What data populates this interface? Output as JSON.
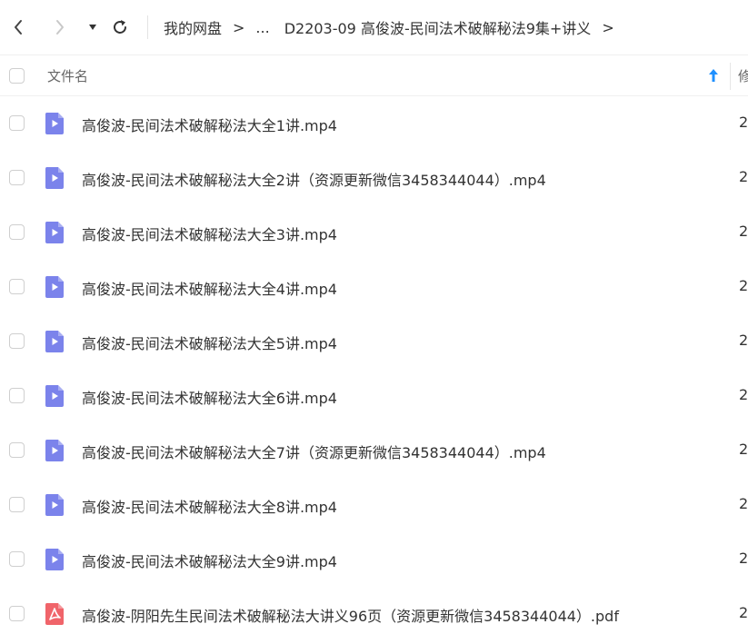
{
  "nav": {
    "back_icon": "chevron-left-icon",
    "forward_icon": "chevron-right-icon",
    "history_icon": "caret-down-icon",
    "refresh_icon": "refresh-icon"
  },
  "breadcrumb": {
    "root": "我的网盘",
    "sep1": ">",
    "ellipsis": "...",
    "current": "D2203-09 高俊波-民间法术破解秘法9集+讲义",
    "sep2": ">"
  },
  "header": {
    "name_label": "文件名",
    "sort_icon": "sort-asc-icon",
    "next_col_partial": "修"
  },
  "files": [
    {
      "name": "高俊波-民间法术破解秘法大全1讲.mp4",
      "type": "video",
      "partial": "2"
    },
    {
      "name": "高俊波-民间法术破解秘法大全2讲（资源更新微信3458344044）.mp4",
      "type": "video",
      "partial": "2"
    },
    {
      "name": "高俊波-民间法术破解秘法大全3讲.mp4",
      "type": "video",
      "partial": "2"
    },
    {
      "name": "高俊波-民间法术破解秘法大全4讲.mp4",
      "type": "video",
      "partial": "2"
    },
    {
      "name": "高俊波-民间法术破解秘法大全5讲.mp4",
      "type": "video",
      "partial": "2"
    },
    {
      "name": "高俊波-民间法术破解秘法大全6讲.mp4",
      "type": "video",
      "partial": "2"
    },
    {
      "name": "高俊波-民间法术破解秘法大全7讲（资源更新微信3458344044）.mp4",
      "type": "video",
      "partial": "2"
    },
    {
      "name": "高俊波-民间法术破解秘法大全8讲.mp4",
      "type": "video",
      "partial": "2"
    },
    {
      "name": "高俊波-民间法术破解秘法大全9讲.mp4",
      "type": "video",
      "partial": "2"
    },
    {
      "name": "高俊波-阴阳先生民间法术破解秘法大讲义96页（资源更新微信3458344044）.pdf",
      "type": "pdf",
      "partial": "2"
    }
  ],
  "colors": {
    "video_icon": "#7b83eb",
    "pdf_icon": "#f0646a",
    "sort_accent": "#1e90ff"
  }
}
